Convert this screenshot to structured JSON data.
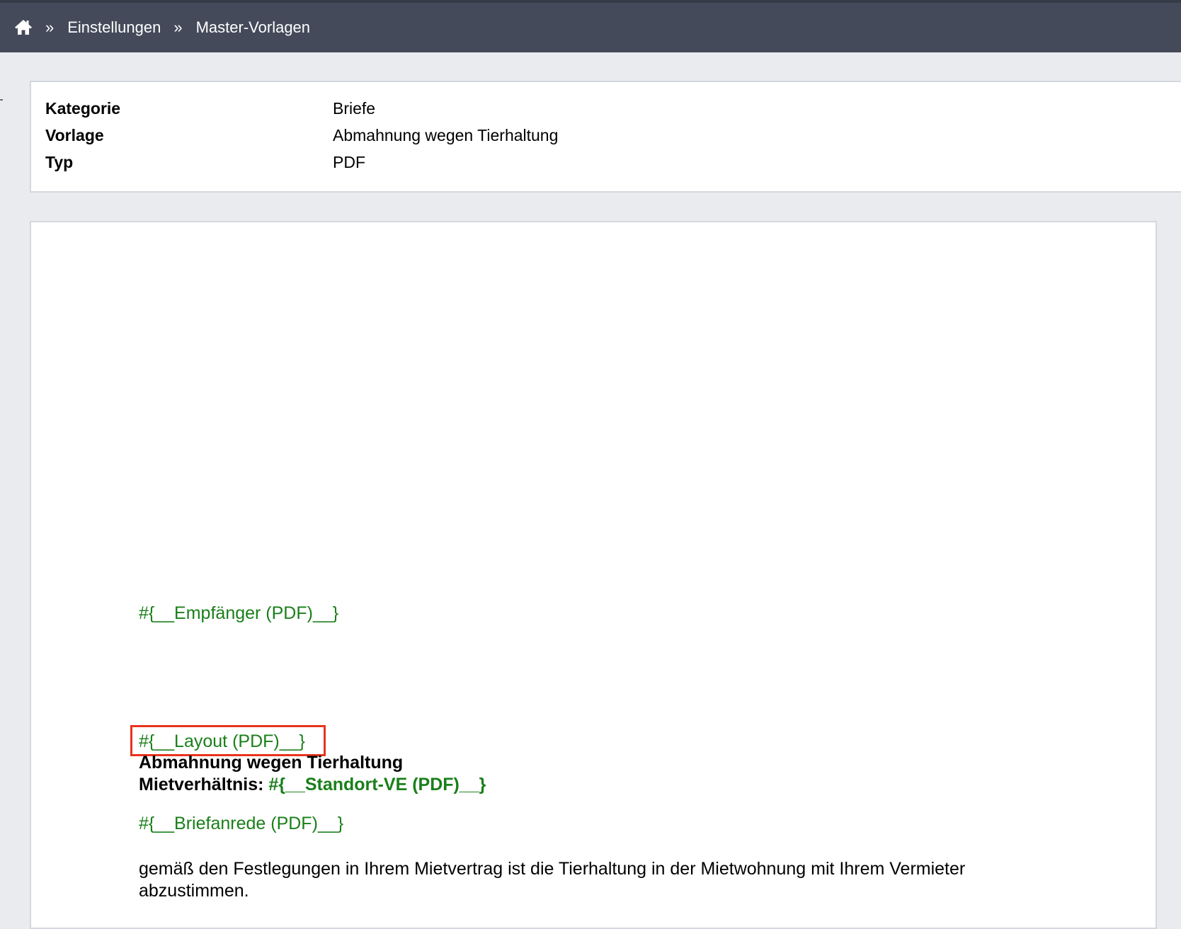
{
  "header": {
    "home_icon": "home-icon",
    "separator": "»",
    "breadcrumbs": [
      {
        "label": "Einstellungen"
      },
      {
        "label": "Master-Vorlagen"
      }
    ]
  },
  "info": {
    "rows": [
      {
        "label": "Kategorie",
        "value": "Briefe"
      },
      {
        "label": "Vorlage",
        "value": "Abmahnung wegen Tierhaltung"
      },
      {
        "label": "Typ",
        "value": "PDF"
      }
    ]
  },
  "document": {
    "recipient_placeholder": "#{__Empfänger (PDF)__}",
    "layout_placeholder": "#{__Layout (PDF)__}",
    "subject": "Abmahnung wegen Tierhaltung",
    "tenancy_label": "Mietverhältnis: ",
    "tenancy_placeholder": "#{__Standort-VE (PDF)__}",
    "salutation_placeholder": "#{__Briefanrede (PDF)__}",
    "body_text": "gemäß den Festlegungen in Ihrem Mietvertrag ist die Tierhaltung in der Mietwohnung mit Ihrem Vermieter abzustimmen."
  },
  "colors": {
    "topbar": "#444a5a",
    "placeholder_green": "#1a7f1a",
    "highlight_red": "#e8331e"
  }
}
